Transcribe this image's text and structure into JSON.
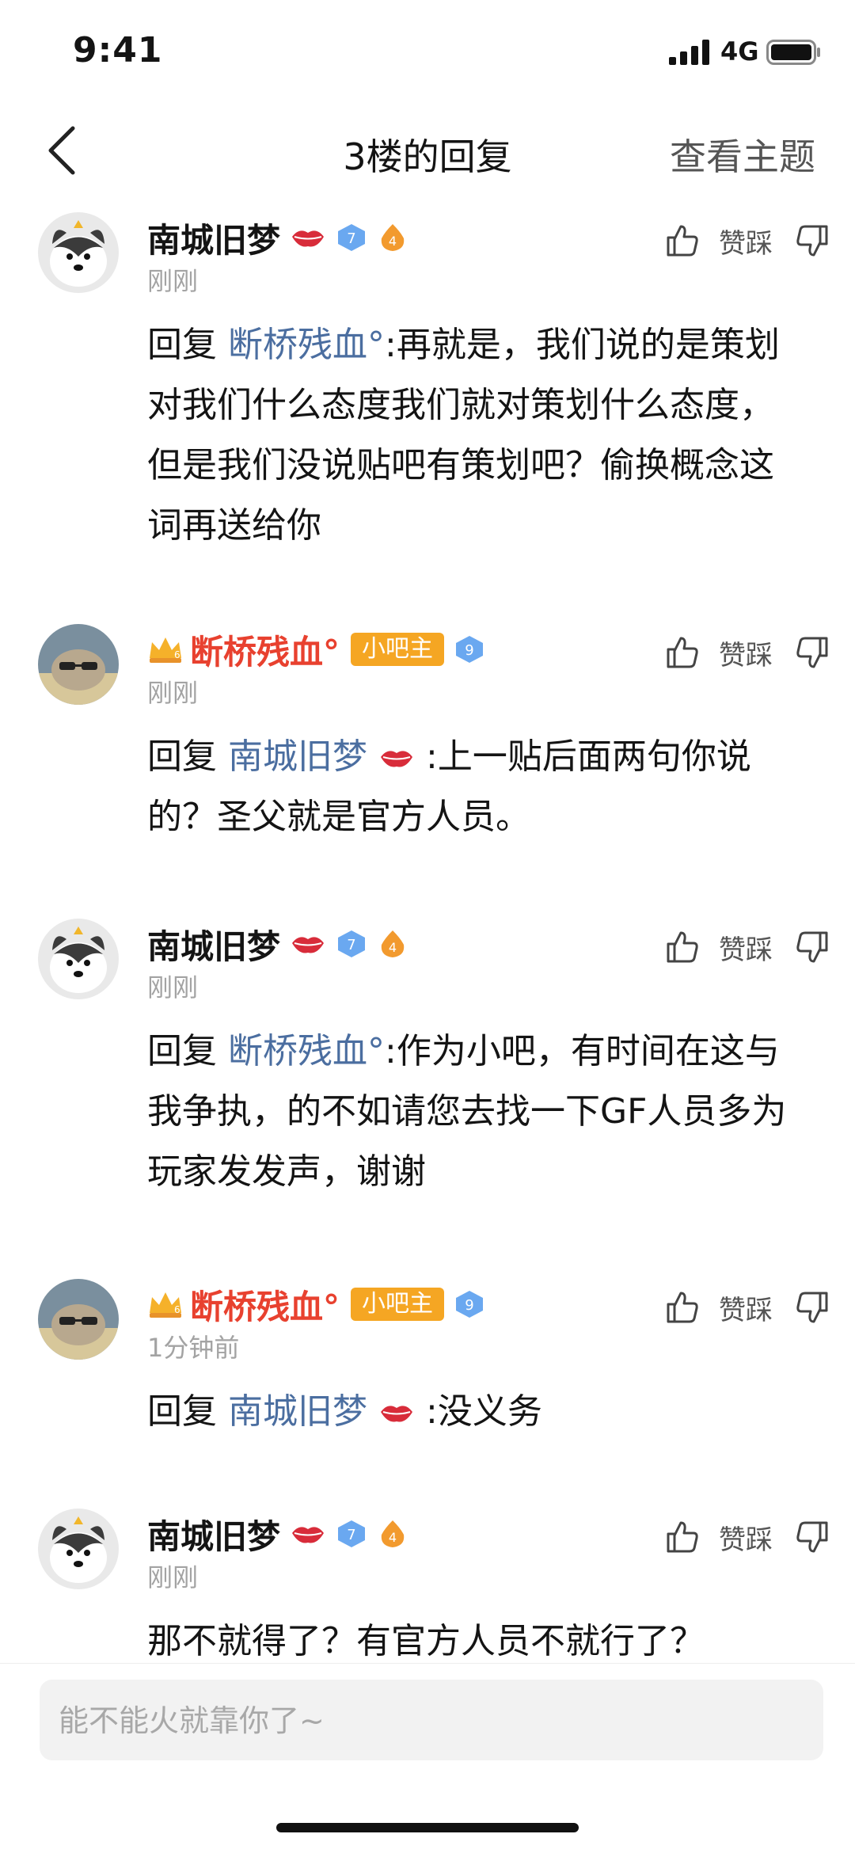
{
  "status": {
    "time": "9:41",
    "network": "4G"
  },
  "nav": {
    "title": "3楼的回复",
    "view_topic": "查看主题"
  },
  "action_label": "赞踩",
  "replies": [
    {
      "user": "南城旧梦",
      "time": "刚刚",
      "prefix": "回复",
      "mention": "断桥残血°",
      "text": ":再就是，我们说的是策划对我们什么态度我们就对策划什么态度，但是我们没说贴吧有策划吧？偷换概念这词再送给你"
    },
    {
      "user": "断桥残血°",
      "badge": "小吧主",
      "time": "刚刚",
      "prefix": "回复",
      "mention": "南城旧梦",
      "text": ":上一贴后面两句你说的？圣父就是官方人员。"
    },
    {
      "user": "南城旧梦",
      "time": "刚刚",
      "prefix": "回复",
      "mention": "断桥残血°",
      "text": ":作为小吧，有时间在这与我争执，的不如请您去找一下GF人员多为玩家发发声，谢谢"
    },
    {
      "user": "断桥残血°",
      "badge": "小吧主",
      "time": "1分钟前",
      "prefix": "回复",
      "mention": "南城旧梦",
      "text": ":没义务"
    },
    {
      "user": "南城旧梦",
      "time": "刚刚",
      "text": "那不就得了？有官方人员不就行了？"
    }
  ],
  "input": {
    "placeholder": "能不能火就靠你了~"
  }
}
